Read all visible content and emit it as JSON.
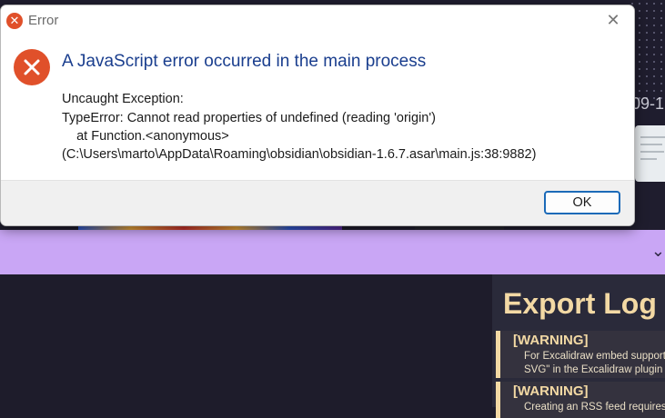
{
  "background": {
    "date_fragment": "09-1",
    "chevron": "⌄",
    "export_log": {
      "title": "Export Log",
      "entries": [
        {
          "label": "[WARNING]",
          "lines": [
            "For Excalidraw embed support",
            "SVG\" in the Excalidraw plugin"
          ]
        },
        {
          "label": "[WARNING]",
          "lines": [
            "Creating an RSS feed requires"
          ]
        }
      ]
    }
  },
  "dialog": {
    "window_title": "Error",
    "heading": "A JavaScript error occurred in the main process",
    "message_lines": [
      "Uncaught Exception:",
      "TypeError: Cannot read properties of undefined (reading 'origin')",
      "    at Function.<anonymous>",
      "(C:\\Users\\marto\\AppData\\Roaming\\obsidian\\obsidian-1.6.7.asar\\main.js:38:9882)"
    ],
    "ok_label": "OK",
    "close_glyph": "✕",
    "icons": {
      "title": "error-icon",
      "body": "error-icon",
      "close": "close-icon"
    },
    "accent_color": "#e0502a",
    "heading_color": "#1a3e8e"
  }
}
